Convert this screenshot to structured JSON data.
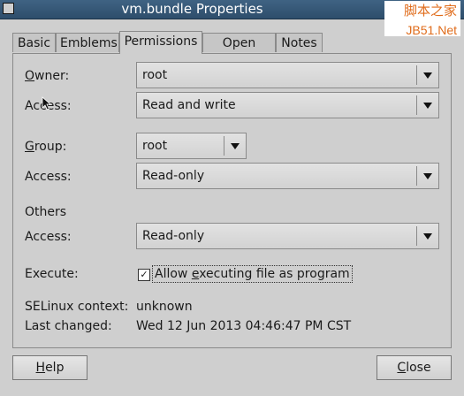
{
  "window": {
    "title": "vm.bundle Properties",
    "watermark_line1": "脚本之家",
    "watermark_line2": "JB51.Net"
  },
  "tabs": [
    {
      "label": "Basic"
    },
    {
      "label": "Emblems"
    },
    {
      "label": "Permissions",
      "active": true
    },
    {
      "label": "Open With"
    },
    {
      "label": "Notes"
    }
  ],
  "owner": {
    "label": "Owner:",
    "value": "root"
  },
  "owner_access": {
    "label": "Access:",
    "value": "Read and write"
  },
  "group": {
    "label": "Group:",
    "value": "root"
  },
  "group_access": {
    "label": "Access:",
    "value": "Read-only"
  },
  "others": {
    "heading": "Others",
    "access_label": "Access:",
    "access_value": "Read-only"
  },
  "execute": {
    "label": "Execute:",
    "checkbox_label": "Allow executing file as program",
    "checked": true
  },
  "selinux": {
    "label": "SELinux context:",
    "value": "unknown"
  },
  "last_changed": {
    "label": "Last changed:",
    "value": "Wed 12 Jun 2013 04:46:47 PM CST"
  },
  "buttons": {
    "help": "Help",
    "close": "Close"
  },
  "icons": {
    "window_menu": "window-menu-icon",
    "dropdown": "chevron-down-icon",
    "check": "check-icon",
    "cursor": "mouse-pointer-icon"
  }
}
